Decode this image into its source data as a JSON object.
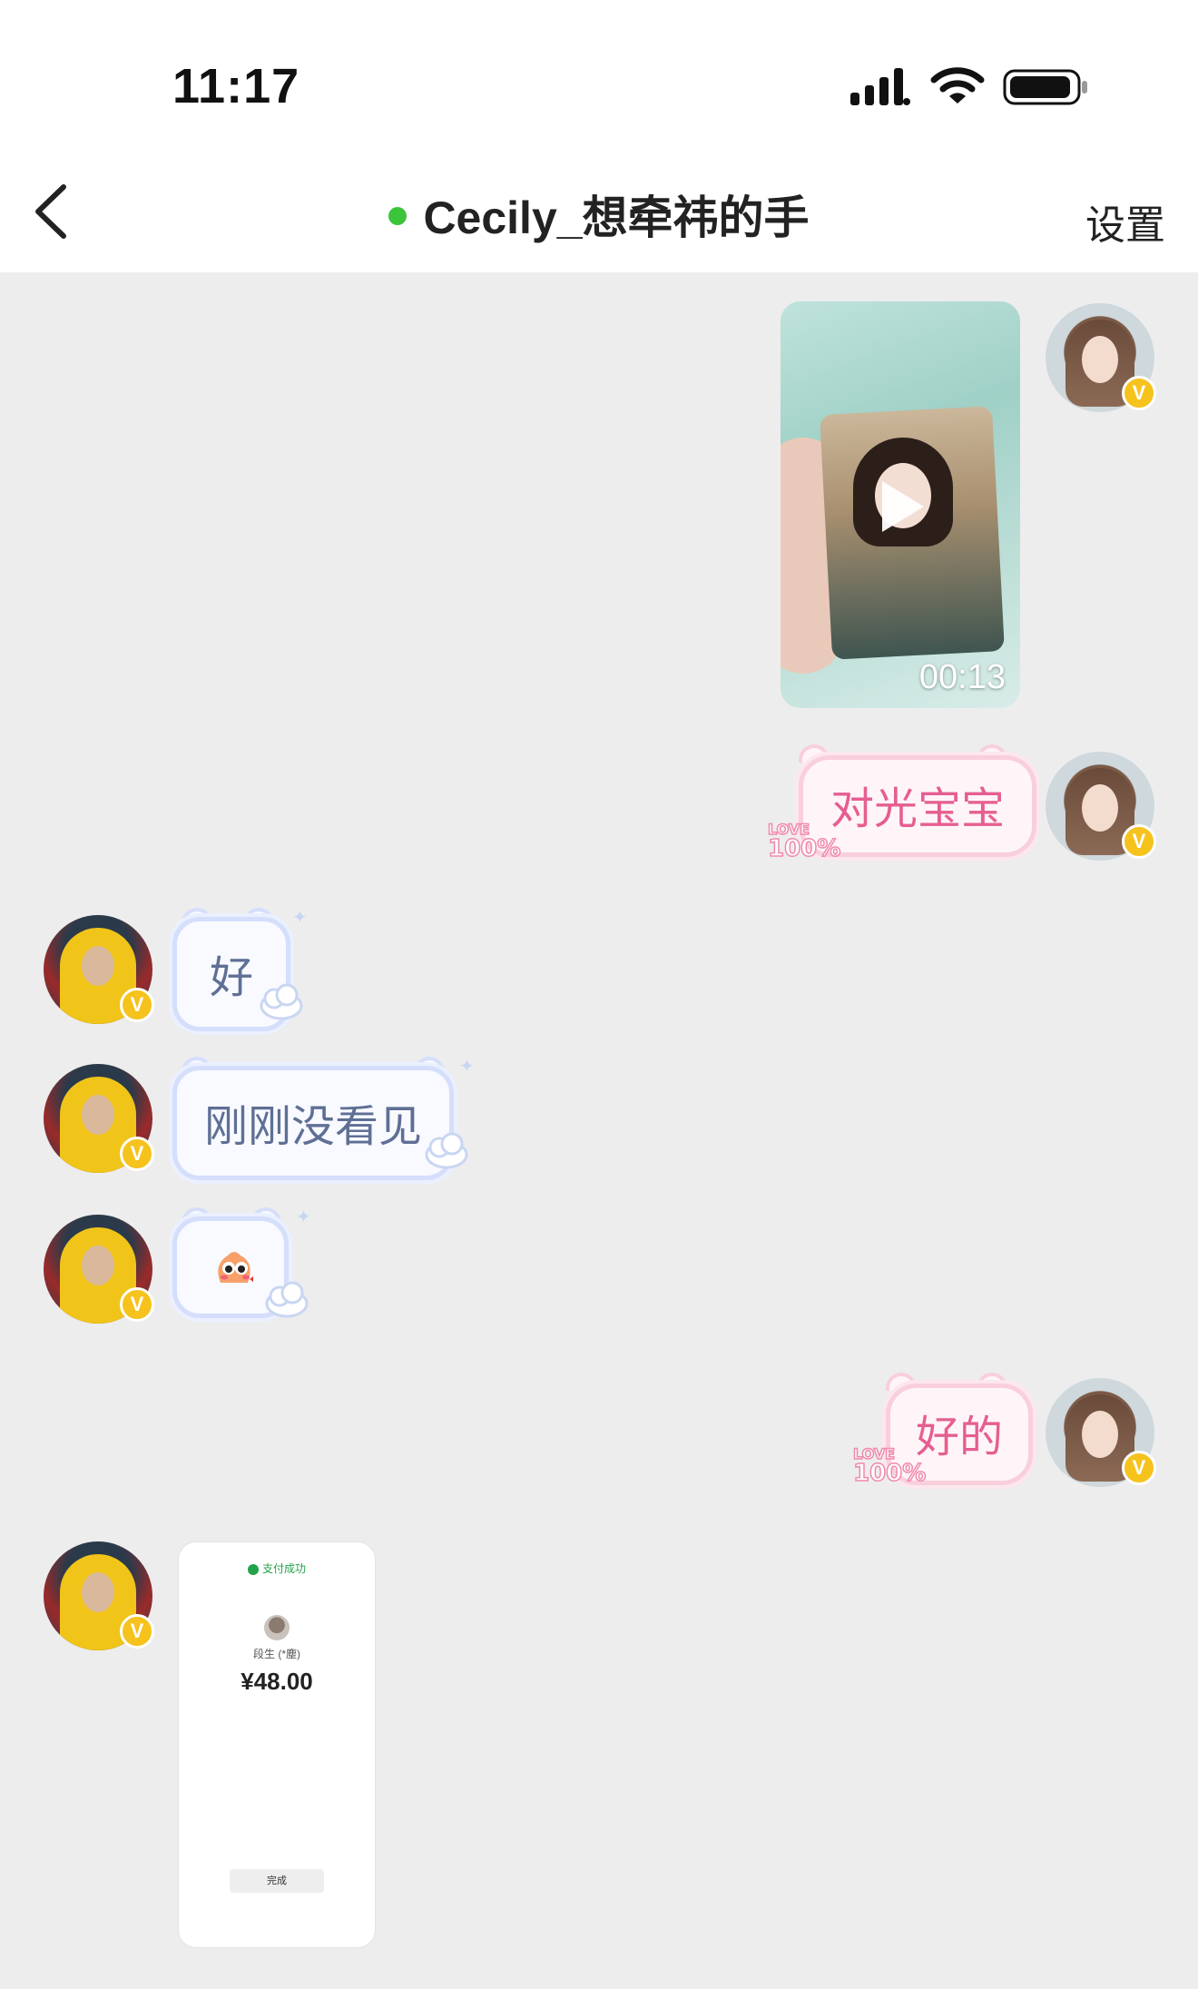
{
  "status_bar": {
    "time": "11:17"
  },
  "header": {
    "title": "Cecily_想牵祎的手",
    "settings_label": "设置",
    "online_color": "#3cc43a"
  },
  "messages": [
    {
      "side": "right",
      "type": "video",
      "duration": "00:13"
    },
    {
      "side": "right",
      "type": "text",
      "text": "对光宝宝",
      "bubble_style": "pink-love"
    },
    {
      "side": "left",
      "type": "text",
      "text": "好",
      "bubble_style": "blue-cloud"
    },
    {
      "side": "left",
      "type": "text",
      "text": "刚刚没看见",
      "bubble_style": "blue-cloud"
    },
    {
      "side": "left",
      "type": "emoji",
      "emoji_name": "blushing-face-emoji",
      "bubble_style": "blue-cloud"
    },
    {
      "side": "right",
      "type": "text",
      "text": "好的",
      "bubble_style": "pink-love"
    },
    {
      "side": "left",
      "type": "image",
      "image": {
        "header": "支付成功",
        "name": "段生 (*塵)",
        "amount": "¥48.00",
        "button": "完成"
      }
    }
  ],
  "love_stamp": {
    "line1": "LOVE",
    "line2": "100%"
  },
  "badge_label": "V",
  "colors": {
    "background": "#ededed",
    "pink_bubble_border": "#f9cfdc",
    "pink_text": "#e65e91",
    "blue_bubble_border": "#d5defb",
    "blue_text": "#5f6f95",
    "verified_badge": "#f6c21c"
  }
}
